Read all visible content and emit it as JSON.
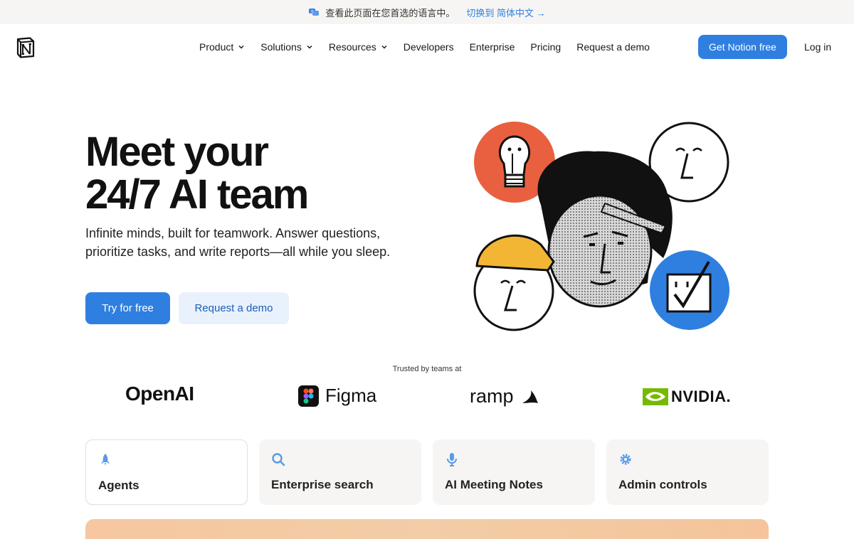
{
  "banner": {
    "message": "查看此页面在您首选的语言中。",
    "switch_label": "切换到 简体中文 →"
  },
  "nav": {
    "items": [
      {
        "label": "Product",
        "dropdown": true
      },
      {
        "label": "Solutions",
        "dropdown": true
      },
      {
        "label": "Resources",
        "dropdown": true
      },
      {
        "label": "Developers",
        "dropdown": false
      },
      {
        "label": "Enterprise",
        "dropdown": false
      },
      {
        "label": "Pricing",
        "dropdown": false
      },
      {
        "label": "Request a demo",
        "dropdown": false
      }
    ],
    "cta_label": "Get Notion free",
    "login_label": "Log in"
  },
  "hero": {
    "title_line1": "Meet your",
    "title_line2": "24/7 AI team",
    "subtitle": "Infinite minds, built for teamwork. Answer questions, prioritize tasks, and write reports—all while you sleep.",
    "primary_cta": "Try for free",
    "secondary_cta": "Request a demo"
  },
  "trusted": {
    "label": "Trusted by teams at",
    "logos": [
      "OpenAI",
      "Figma",
      "ramp",
      "NVIDIA."
    ]
  },
  "features": [
    {
      "label": "Agents",
      "icon": "rocket-icon",
      "active": true
    },
    {
      "label": "Enterprise search",
      "icon": "search-icon",
      "active": false
    },
    {
      "label": "AI Meeting Notes",
      "icon": "microphone-icon",
      "active": false
    },
    {
      "label": "Admin controls",
      "icon": "gear-icon",
      "active": false
    }
  ],
  "colors": {
    "accent": "#2f7fe0",
    "orange_circle": "#e8603f",
    "blue_circle": "#2f7fe0",
    "helmet_yellow": "#f3b634"
  }
}
